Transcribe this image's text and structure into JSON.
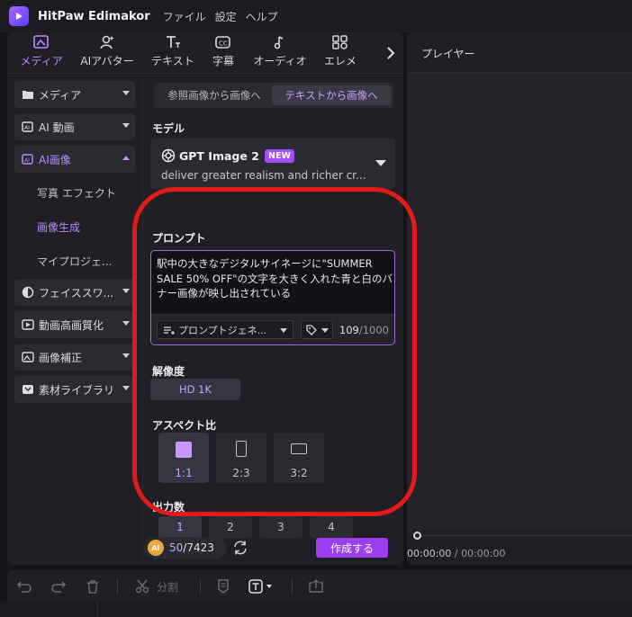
{
  "app": {
    "title": "HitPaw Edimakor",
    "menu": [
      "ファイル",
      "設定",
      "ヘルプ"
    ]
  },
  "toolbar": {
    "tabs": [
      {
        "label": "メディア",
        "icon": "media-icon",
        "active": true
      },
      {
        "label": "AIアバター",
        "icon": "avatar-icon"
      },
      {
        "label": "テキスト",
        "icon": "text-icon"
      },
      {
        "label": "字幕",
        "icon": "subtitle-icon"
      },
      {
        "label": "オーディオ",
        "icon": "audio-icon"
      },
      {
        "label": "エレメ",
        "icon": "element-icon"
      }
    ]
  },
  "sidebar": {
    "items": [
      {
        "label": "メディア",
        "icon": "folder-icon"
      },
      {
        "label": "AI 動画",
        "icon": "ai-video-icon"
      },
      {
        "label": "AI画像",
        "icon": "ai-image-icon",
        "active": true
      },
      {
        "label": "フェイススワ...",
        "icon": "face-swap-icon"
      },
      {
        "label": "動画高画質化",
        "icon": "enhance-icon"
      },
      {
        "label": "画像補正",
        "icon": "image-fix-icon"
      },
      {
        "label": "素材ライブラリ",
        "icon": "library-icon"
      }
    ],
    "sub_items": [
      {
        "label": "写真 エフェクト"
      },
      {
        "label": "画像生成",
        "active": true
      },
      {
        "label": "マイプロジェ..."
      }
    ]
  },
  "content": {
    "segments": [
      "参照画像から画像へ",
      "テキストから画像へ"
    ],
    "model_label": "モデル",
    "model_name": "GPT Image 2",
    "model_badge": "NEW",
    "model_desc": "deliver greater realism and richer cr...",
    "prompt_label": "プロンプト",
    "prompt_text": "駅中の大きなデジタルサイネージに\"SUMMER SALE 50% OFF\"の文字を大きく入れた青と白のバナー画像が映し出されている",
    "prompt_guide": "プロンプトジェネ...",
    "char_count": "109",
    "char_max": "/1000",
    "resolution_label": "解像度",
    "resolution_value": "HD 1K",
    "aspect_label": "アスペクト比",
    "aspects": [
      "1:1",
      "2:3",
      "3:2"
    ],
    "count_label": "出力数",
    "counts": [
      "1",
      "2",
      "3",
      "4"
    ],
    "credits_used": "50",
    "credits_total": "/7423",
    "coin_text": "AI",
    "create_button": "作成する"
  },
  "player": {
    "title": "プレイヤー",
    "current_time": "00:00:00",
    "total_time": " / 00:00:00"
  },
  "timeline": {
    "split_label": "分割"
  },
  "colors": {
    "accent": "#b88cff",
    "create_button": "#9a3ff0",
    "highlight": "#e21a1a"
  }
}
